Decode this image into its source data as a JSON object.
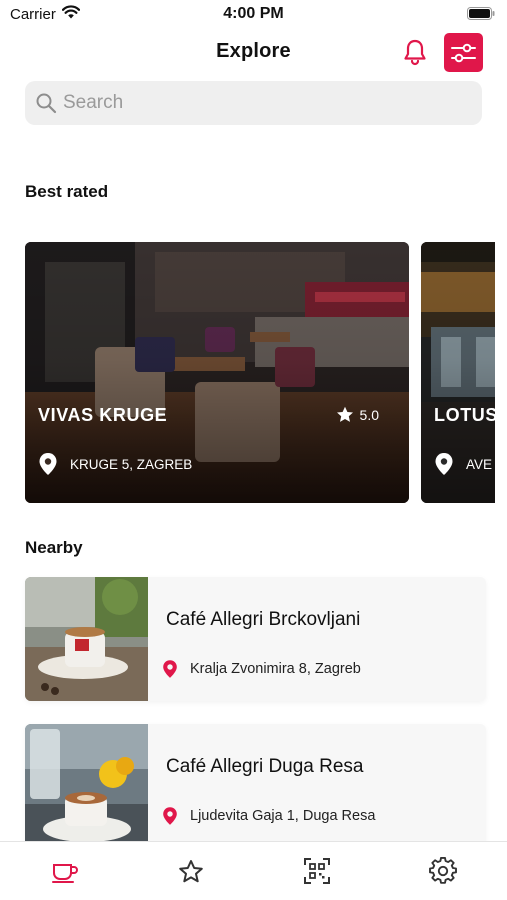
{
  "status_bar": {
    "carrier": "Carrier",
    "time": "4:00 PM"
  },
  "header": {
    "title": "Explore"
  },
  "search": {
    "placeholder": "Search",
    "value": ""
  },
  "sections": {
    "best_rated": "Best rated",
    "nearby": "Nearby"
  },
  "best_rated": [
    {
      "name": "VIVAS KRUGE",
      "rating": "5.0",
      "address": "KRUGE 5, ZAGREB"
    },
    {
      "name": "LOTUS",
      "address": "AVE"
    }
  ],
  "nearby": [
    {
      "name": "Café Allegri Brckovljani",
      "address": "Kralja Zvonimira  8, Zagreb"
    },
    {
      "name": "Café Allegri Duga Resa",
      "address": "Ljudevita Gaja 1, Duga Resa"
    }
  ],
  "icons": {
    "bell": "bell-icon",
    "filter": "sliders-icon",
    "search": "search-icon",
    "star": "star-icon",
    "pin": "location-pin-icon",
    "tabs": [
      "coffee-cup-icon",
      "star-icon",
      "qr-code-icon",
      "gear-icon"
    ]
  },
  "colors": {
    "accent": "#e0174a",
    "background": "#ffffff",
    "search_bg": "#efefef",
    "tab_inactive": "#333333"
  },
  "tabs": {
    "active_index": 0
  }
}
